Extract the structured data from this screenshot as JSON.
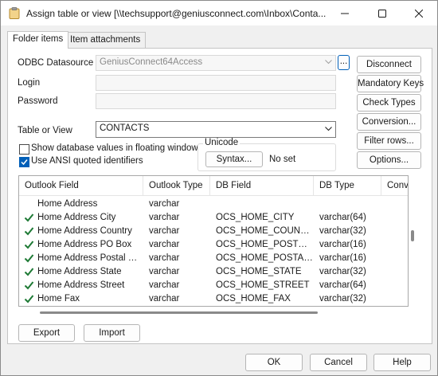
{
  "window": {
    "title": "Assign table or view [\\\\techsupport@geniusconnect.com\\Inbox\\Conta..."
  },
  "tabs": [
    {
      "label": "Folder items",
      "active": true
    },
    {
      "label": "Item attachments",
      "active": false
    }
  ],
  "form": {
    "odbc_label": "ODBC Datasource",
    "odbc_value": "GeniusConnect64Access",
    "browse_label": "...",
    "login_label": "Login",
    "login_value": "",
    "password_label": "Password",
    "password_value": "",
    "table_label": "Table or View",
    "table_value": "CONTACTS",
    "show_floating_label": "Show database values in floating window",
    "show_floating_checked": false,
    "ansi_label": "Use ANSI quoted identifiers",
    "ansi_checked": true
  },
  "unicode": {
    "group_label": "Unicode",
    "syntax_button": "Syntax...",
    "status": "No set"
  },
  "side_buttons": {
    "disconnect": "Disconnect",
    "mandatory_keys": "Mandatory Keys",
    "check_types": "Check Types",
    "conversion": "Conversion...",
    "filter_rows": "Filter rows...",
    "options": "Options..."
  },
  "list": {
    "columns": [
      "Outlook Field",
      "Outlook Type",
      "DB Field",
      "DB Type",
      "Conv"
    ],
    "rows": [
      {
        "outlook_field": "Home Address",
        "outlook_type": "varchar",
        "db_field": "",
        "db_type": "",
        "checked": false
      },
      {
        "outlook_field": "Home Address City",
        "outlook_type": "varchar",
        "db_field": "OCS_HOME_CITY",
        "db_type": "varchar(64)",
        "checked": true
      },
      {
        "outlook_field": "Home Address Country",
        "outlook_type": "varchar",
        "db_field": "OCS_HOME_COUNTRY",
        "db_type": "varchar(32)",
        "checked": true
      },
      {
        "outlook_field": "Home Address PO Box",
        "outlook_type": "varchar",
        "db_field": "OCS_HOME_POSTOF...",
        "db_type": "varchar(16)",
        "checked": true
      },
      {
        "outlook_field": "Home Address Postal Code",
        "outlook_type": "varchar",
        "db_field": "OCS_HOME_POSTAL...",
        "db_type": "varchar(16)",
        "checked": true
      },
      {
        "outlook_field": "Home Address State",
        "outlook_type": "varchar",
        "db_field": "OCS_HOME_STATE",
        "db_type": "varchar(32)",
        "checked": true
      },
      {
        "outlook_field": "Home Address Street",
        "outlook_type": "varchar",
        "db_field": "OCS_HOME_STREET",
        "db_type": "varchar(64)",
        "checked": true
      },
      {
        "outlook_field": "Home Fax",
        "outlook_type": "varchar",
        "db_field": "OCS_HOME_FAX",
        "db_type": "varchar(32)",
        "checked": true
      }
    ]
  },
  "bottom_buttons": {
    "export": "Export",
    "import": "Import"
  },
  "footer": {
    "ok": "OK",
    "cancel": "Cancel",
    "help": "Help"
  },
  "colors": {
    "check_green": "#1e7a35",
    "accent_blue": "#005fb8"
  },
  "icons": {
    "app": "clipboard-icon",
    "minimize": "minimize-icon",
    "maximize": "maximize-icon",
    "close": "close-icon"
  }
}
